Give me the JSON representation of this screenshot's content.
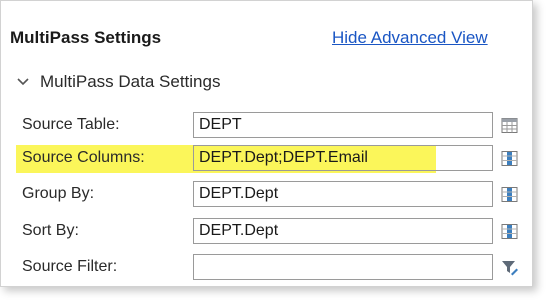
{
  "header": {
    "title": "MultiPass Settings",
    "advanced_link": "Hide Advanced View"
  },
  "section": {
    "label": "MultiPass Data Settings",
    "icon": "chevron-down-icon"
  },
  "fields": [
    {
      "label": "Source Table:",
      "value": "DEPT",
      "icon": "table-grid-icon"
    },
    {
      "label": "Source Columns:",
      "value": "DEPT.Dept;DEPT.Email",
      "icon": "column-picker-icon",
      "highlighted": true
    },
    {
      "label": "Group By:",
      "value": "DEPT.Dept",
      "icon": "column-picker-icon"
    },
    {
      "label": "Sort By:",
      "value": "DEPT.Dept",
      "icon": "column-picker-icon"
    },
    {
      "label": "Source Filter:",
      "value": "",
      "icon": "filter-edit-icon"
    }
  ],
  "colors": {
    "link": "#1a56c4",
    "highlight": "#fbf65a",
    "icon_blue": "#3c7fbf"
  }
}
